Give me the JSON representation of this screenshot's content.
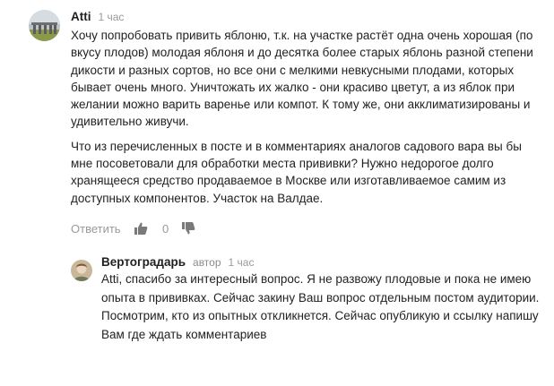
{
  "comments": [
    {
      "author": "Atti",
      "time": "1 час",
      "paragraphs": [
        "Хочу попробовать привить яблоню, т.к. на участке растёт одна очень хорошая (по вкусу плодов) молодая яблоня и до десятка более старых яблонь разной степени дикости и разных сортов, но все они с мелкими невкусными плодами, которых бывает очень много. Уничтожать их жалко - они красиво цветут, а из яблок при желании можно варить варенье или компот. К тому же, они акклиматизированы и удивительно живучи.",
        "Что из перечисленных в посте и в комментариях аналогов садового вара вы бы мне посоветовали для обработки места прививки? Нужно недорогое долго хранящееся средство продаваемое в Москве или изготавливаемое самим из доступных компонентов. Участок на Валдае."
      ],
      "reply_label": "Ответить",
      "like_icon": "thumbs-up-icon",
      "like_count": "0",
      "dislike_icon": "thumbs-down-icon"
    },
    {
      "author": "Вертоградарь",
      "role": "автор",
      "time": "1 час",
      "paragraphs": [
        "Atti, спасибо за интересный вопрос. Я не развожу плодовые и пока не имею опыта в прививках. Сейчас закину Ваш вопрос отдельным постом аудитории. Посмотрим, кто из опытных откликнется. Сейчас опубликую и ссылку напишу Вам где ждать комментариев"
      ]
    }
  ],
  "colors": {
    "text": "#222222",
    "muted": "#9a9a9a",
    "icon": "#7a7a7a"
  }
}
